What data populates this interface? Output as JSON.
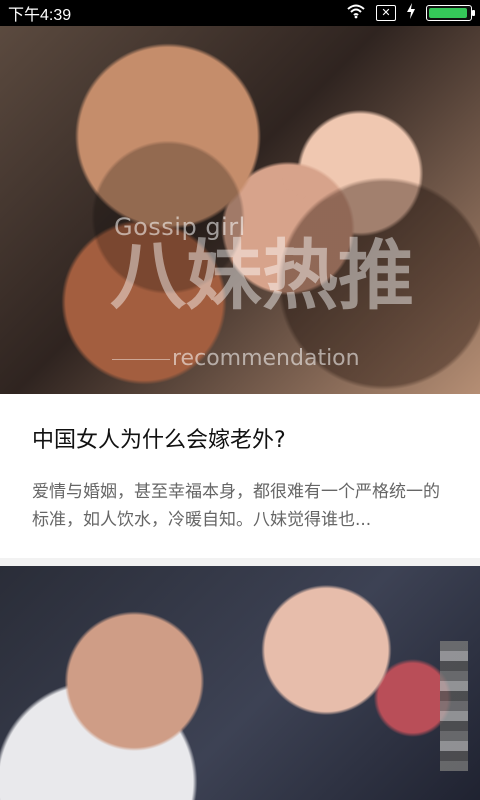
{
  "status_bar": {
    "time": "下午4:39",
    "icons": [
      "wifi-icon",
      "no-sim-icon",
      "charging-icon",
      "battery-icon"
    ],
    "battery_level": 1.0
  },
  "feed": {
    "items": [
      {
        "image_text": {
          "top": "Gossip girl",
          "main": "八妹热推",
          "bottom": "recommendation"
        },
        "title": "中国女人为什么会嫁老外?",
        "snippet": "爱情与婚姻，甚至幸福本身，都很难有一个严格统一的标准，如人饮水，冷暖自知。八妹觉得谁也..."
      },
      {
        "title": "",
        "snippet": ""
      }
    ]
  },
  "colors": {
    "status_bg": "#000000",
    "battery_fill": "#35c759",
    "card_bg": "#ffffff",
    "separator": "#f2f2f2"
  }
}
